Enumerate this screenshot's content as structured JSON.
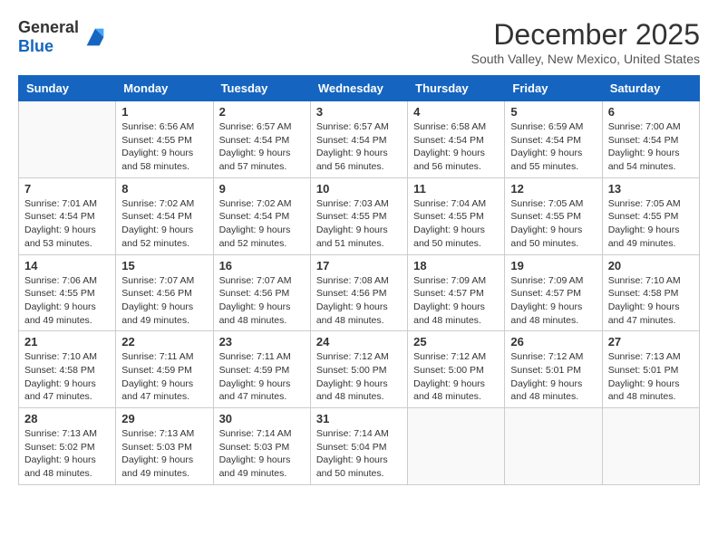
{
  "logo": {
    "general": "General",
    "blue": "Blue"
  },
  "title": "December 2025",
  "location": "South Valley, New Mexico, United States",
  "days_header": [
    "Sunday",
    "Monday",
    "Tuesday",
    "Wednesday",
    "Thursday",
    "Friday",
    "Saturday"
  ],
  "weeks": [
    [
      {
        "day": "",
        "info": ""
      },
      {
        "day": "1",
        "info": "Sunrise: 6:56 AM\nSunset: 4:55 PM\nDaylight: 9 hours\nand 58 minutes."
      },
      {
        "day": "2",
        "info": "Sunrise: 6:57 AM\nSunset: 4:54 PM\nDaylight: 9 hours\nand 57 minutes."
      },
      {
        "day": "3",
        "info": "Sunrise: 6:57 AM\nSunset: 4:54 PM\nDaylight: 9 hours\nand 56 minutes."
      },
      {
        "day": "4",
        "info": "Sunrise: 6:58 AM\nSunset: 4:54 PM\nDaylight: 9 hours\nand 56 minutes."
      },
      {
        "day": "5",
        "info": "Sunrise: 6:59 AM\nSunset: 4:54 PM\nDaylight: 9 hours\nand 55 minutes."
      },
      {
        "day": "6",
        "info": "Sunrise: 7:00 AM\nSunset: 4:54 PM\nDaylight: 9 hours\nand 54 minutes."
      }
    ],
    [
      {
        "day": "7",
        "info": "Sunrise: 7:01 AM\nSunset: 4:54 PM\nDaylight: 9 hours\nand 53 minutes."
      },
      {
        "day": "8",
        "info": "Sunrise: 7:02 AM\nSunset: 4:54 PM\nDaylight: 9 hours\nand 52 minutes."
      },
      {
        "day": "9",
        "info": "Sunrise: 7:02 AM\nSunset: 4:54 PM\nDaylight: 9 hours\nand 52 minutes."
      },
      {
        "day": "10",
        "info": "Sunrise: 7:03 AM\nSunset: 4:55 PM\nDaylight: 9 hours\nand 51 minutes."
      },
      {
        "day": "11",
        "info": "Sunrise: 7:04 AM\nSunset: 4:55 PM\nDaylight: 9 hours\nand 50 minutes."
      },
      {
        "day": "12",
        "info": "Sunrise: 7:05 AM\nSunset: 4:55 PM\nDaylight: 9 hours\nand 50 minutes."
      },
      {
        "day": "13",
        "info": "Sunrise: 7:05 AM\nSunset: 4:55 PM\nDaylight: 9 hours\nand 49 minutes."
      }
    ],
    [
      {
        "day": "14",
        "info": "Sunrise: 7:06 AM\nSunset: 4:55 PM\nDaylight: 9 hours\nand 49 minutes."
      },
      {
        "day": "15",
        "info": "Sunrise: 7:07 AM\nSunset: 4:56 PM\nDaylight: 9 hours\nand 49 minutes."
      },
      {
        "day": "16",
        "info": "Sunrise: 7:07 AM\nSunset: 4:56 PM\nDaylight: 9 hours\nand 48 minutes."
      },
      {
        "day": "17",
        "info": "Sunrise: 7:08 AM\nSunset: 4:56 PM\nDaylight: 9 hours\nand 48 minutes."
      },
      {
        "day": "18",
        "info": "Sunrise: 7:09 AM\nSunset: 4:57 PM\nDaylight: 9 hours\nand 48 minutes."
      },
      {
        "day": "19",
        "info": "Sunrise: 7:09 AM\nSunset: 4:57 PM\nDaylight: 9 hours\nand 48 minutes."
      },
      {
        "day": "20",
        "info": "Sunrise: 7:10 AM\nSunset: 4:58 PM\nDaylight: 9 hours\nand 47 minutes."
      }
    ],
    [
      {
        "day": "21",
        "info": "Sunrise: 7:10 AM\nSunset: 4:58 PM\nDaylight: 9 hours\nand 47 minutes."
      },
      {
        "day": "22",
        "info": "Sunrise: 7:11 AM\nSunset: 4:59 PM\nDaylight: 9 hours\nand 47 minutes."
      },
      {
        "day": "23",
        "info": "Sunrise: 7:11 AM\nSunset: 4:59 PM\nDaylight: 9 hours\nand 47 minutes."
      },
      {
        "day": "24",
        "info": "Sunrise: 7:12 AM\nSunset: 5:00 PM\nDaylight: 9 hours\nand 48 minutes."
      },
      {
        "day": "25",
        "info": "Sunrise: 7:12 AM\nSunset: 5:00 PM\nDaylight: 9 hours\nand 48 minutes."
      },
      {
        "day": "26",
        "info": "Sunrise: 7:12 AM\nSunset: 5:01 PM\nDaylight: 9 hours\nand 48 minutes."
      },
      {
        "day": "27",
        "info": "Sunrise: 7:13 AM\nSunset: 5:01 PM\nDaylight: 9 hours\nand 48 minutes."
      }
    ],
    [
      {
        "day": "28",
        "info": "Sunrise: 7:13 AM\nSunset: 5:02 PM\nDaylight: 9 hours\nand 48 minutes."
      },
      {
        "day": "29",
        "info": "Sunrise: 7:13 AM\nSunset: 5:03 PM\nDaylight: 9 hours\nand 49 minutes."
      },
      {
        "day": "30",
        "info": "Sunrise: 7:14 AM\nSunset: 5:03 PM\nDaylight: 9 hours\nand 49 minutes."
      },
      {
        "day": "31",
        "info": "Sunrise: 7:14 AM\nSunset: 5:04 PM\nDaylight: 9 hours\nand 50 minutes."
      },
      {
        "day": "",
        "info": ""
      },
      {
        "day": "",
        "info": ""
      },
      {
        "day": "",
        "info": ""
      }
    ]
  ]
}
